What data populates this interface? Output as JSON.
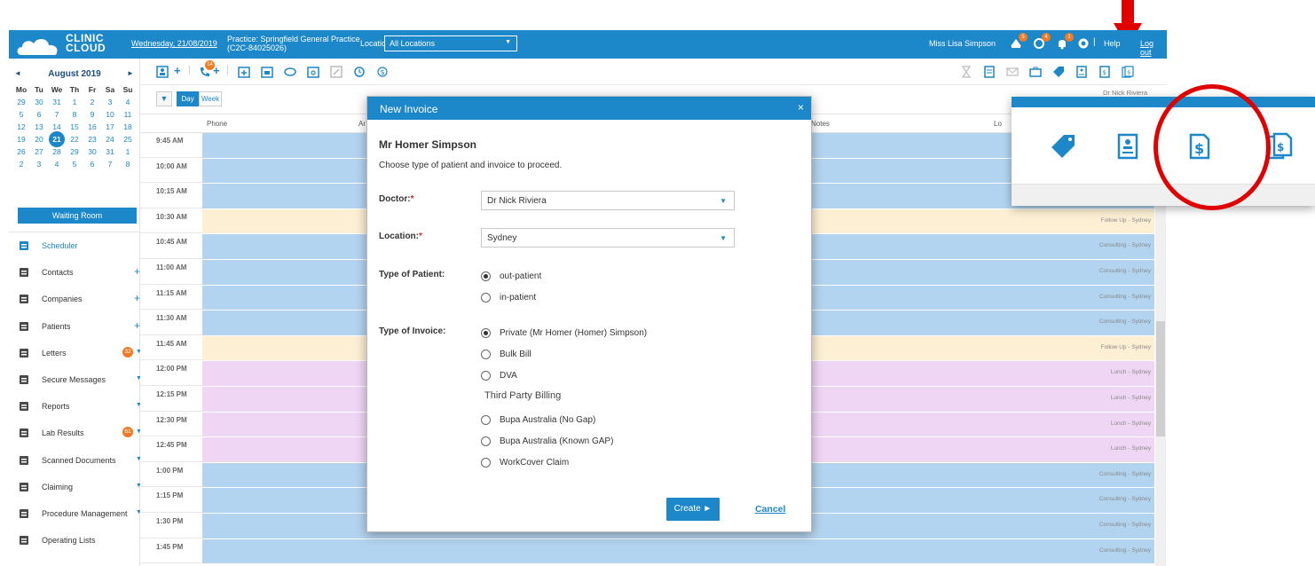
{
  "header": {
    "logo_text_1": "CLINIC",
    "logo_text_2": "CLOUD",
    "date": "Wednesday, 21/08/2019",
    "practice_line1": "Practice: Springfield General Practice",
    "practice_line2": "(C2C-84025026)",
    "location_label": "Location:",
    "location_value": "All Locations",
    "user": "Miss Lisa Simpson",
    "badges": [
      "5",
      "4",
      "1"
    ],
    "separator": "|",
    "help": "Help",
    "logout": "Log out"
  },
  "calendar": {
    "month": "August 2019",
    "prev": "◄",
    "next": "►",
    "dow": [
      "Mo",
      "Tu",
      "We",
      "Th",
      "Fr",
      "Sa",
      "Su"
    ],
    "weeks": [
      [
        "29",
        "30",
        "31",
        "1",
        "2",
        "3",
        "4"
      ],
      [
        "5",
        "6",
        "7",
        "8",
        "9",
        "10",
        "11"
      ],
      [
        "12",
        "13",
        "14",
        "15",
        "16",
        "17",
        "18"
      ],
      [
        "19",
        "20",
        "21",
        "22",
        "23",
        "24",
        "25"
      ],
      [
        "26",
        "27",
        "28",
        "29",
        "30",
        "31",
        "1"
      ],
      [
        "2",
        "3",
        "4",
        "5",
        "6",
        "7",
        "8"
      ]
    ],
    "selected": "21"
  },
  "sidebar": {
    "waiting_room": "Waiting Room",
    "items": [
      {
        "label": "Scheduler",
        "icon": "calendar-icon",
        "suffix": ""
      },
      {
        "label": "Contacts",
        "icon": "contacts-icon",
        "suffix": "+"
      },
      {
        "label": "Companies",
        "icon": "building-icon",
        "suffix": "+"
      },
      {
        "label": "Patients",
        "icon": "person-icon",
        "suffix": "+"
      },
      {
        "label": "Letters",
        "icon": "envelope-icon",
        "suffix": "▼",
        "badge": "32"
      },
      {
        "label": "Secure Messages",
        "icon": "secure-mail-icon",
        "suffix": "▼"
      },
      {
        "label": "Reports",
        "icon": "report-icon",
        "suffix": "▼"
      },
      {
        "label": "Lab Results",
        "icon": "lab-icon",
        "suffix": "▼",
        "badge": "61"
      },
      {
        "label": "Scanned Documents",
        "icon": "document-icon",
        "suffix": "▼"
      },
      {
        "label": "Claiming",
        "icon": "layers-icon",
        "suffix": "▼"
      },
      {
        "label": "Procedure Management",
        "icon": "procedure-icon",
        "suffix": "▼"
      },
      {
        "label": "Operating Lists",
        "icon": "list-icon",
        "suffix": ""
      }
    ]
  },
  "toolbar": {
    "phone_badge": "14",
    "plus": "+",
    "separator": "|"
  },
  "view": {
    "filter": "▼",
    "day": "Day",
    "week": "Week",
    "doctor": "Dr Nick Riviera"
  },
  "grid": {
    "columns": [
      "Phone",
      "Ar",
      "Notes",
      "Lo"
    ],
    "slots": [
      {
        "time": "9:45 AM",
        "color": "#b3d4f0",
        "text": ""
      },
      {
        "time": "10:00 AM",
        "color": "#b3d4f0",
        "text": ""
      },
      {
        "time": "10:15 AM",
        "color": "#b3d4f0",
        "text": ""
      },
      {
        "time": "10:30 AM",
        "color": "#fdefd4",
        "text": "Follow Up - Sydney"
      },
      {
        "time": "10:45 AM",
        "color": "#b3d4f0",
        "text": "Consulting - Sydney"
      },
      {
        "time": "11:00 AM",
        "color": "#b3d4f0",
        "text": "Consulting - Sydney"
      },
      {
        "time": "11:15 AM",
        "color": "#b3d4f0",
        "text": "Consulting - Sydney"
      },
      {
        "time": "11:30 AM",
        "color": "#b3d4f0",
        "text": "Consulting - Sydney"
      },
      {
        "time": "11:45 AM",
        "color": "#fdefd4",
        "text": "Follow Up - Sydney"
      },
      {
        "time": "12:00 PM",
        "color": "#efd6f5",
        "text": "Lunch - Sydney"
      },
      {
        "time": "12:15 PM",
        "color": "#efd6f5",
        "text": "Lunch - Sydney"
      },
      {
        "time": "12:30 PM",
        "color": "#efd6f5",
        "text": "Lunch - Sydney"
      },
      {
        "time": "12:45 PM",
        "color": "#efd6f5",
        "text": "Lunch - Sydney"
      },
      {
        "time": "1:00 PM",
        "color": "#b3d4f0",
        "text": "Consulting - Sydney"
      },
      {
        "time": "1:15 PM",
        "color": "#b3d4f0",
        "text": "Consulting - Sydney"
      },
      {
        "time": "1:30 PM",
        "color": "#b3d4f0",
        "text": "Consulting - Sydney"
      },
      {
        "time": "1:45 PM",
        "color": "#b3d4f0",
        "text": "Consulting - Sydney"
      }
    ]
  },
  "modal": {
    "title": "New Invoice",
    "close": "×",
    "patient": "Mr Homer Simpson",
    "instructions": "Choose type of patient and invoice to proceed.",
    "doctor_label": "Doctor:",
    "doctor_value": "Dr Nick Riviera",
    "location_label": "Location:",
    "location_value": "Sydney",
    "required_mark": "*",
    "patient_type_label": "Type of Patient:",
    "patient_types": [
      {
        "label": "out-patient",
        "checked": true
      },
      {
        "label": "in-patient",
        "checked": false
      }
    ],
    "invoice_type_label": "Type of Invoice:",
    "invoice_types": [
      {
        "label": "Private (Mr Homer (Homer) Simpson)",
        "checked": true
      },
      {
        "label": "Bulk Bill",
        "checked": false
      },
      {
        "label": "DVA",
        "checked": false
      }
    ],
    "third_party_heading": "Third Party Billing",
    "third_party": [
      {
        "label": "Bupa Australia (No Gap)",
        "checked": false
      },
      {
        "label": "Bupa Australia (Known GAP)",
        "checked": false
      },
      {
        "label": "WorkCover Claim",
        "checked": false
      }
    ],
    "create": "Create ►",
    "cancel": "Cancel"
  },
  "colors": {
    "primary": "#1c87c9",
    "badge": "#f07b24",
    "highlight": "#e00000",
    "consulting": "#b3d4f0",
    "followup": "#fdefd4",
    "lunch": "#efd6f5"
  },
  "zoom_icons": [
    "tag-icon",
    "patient-card-icon",
    "invoice-icon",
    "multi-invoice-icon"
  ]
}
